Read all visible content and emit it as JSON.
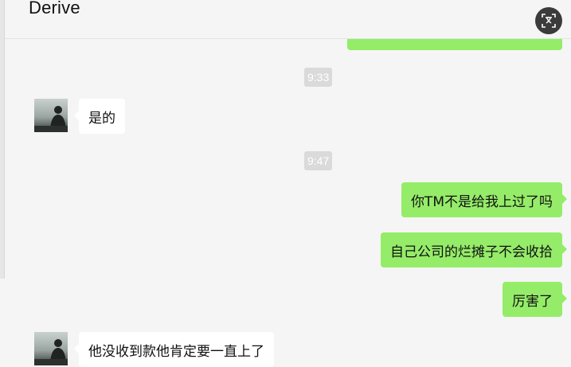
{
  "header": {
    "title": "Derive",
    "translate_icon": "translate-icon"
  },
  "messages": [
    {
      "type": "time",
      "text": "9:33"
    },
    {
      "type": "received",
      "text": "是的"
    },
    {
      "type": "time",
      "text": "9:47"
    },
    {
      "type": "sent",
      "text": "你TM不是给我上过了吗"
    },
    {
      "type": "sent",
      "text": "自己公司的烂摊子不会收拾"
    },
    {
      "type": "sent",
      "text": "厉害了"
    },
    {
      "type": "received",
      "text": "他没收到款他肯定要一直上了"
    }
  ],
  "colors": {
    "background": "#f5f5f5",
    "sent_bubble": "#95ec69",
    "received_bubble": "#ffffff",
    "time_pill": "#dadada"
  }
}
